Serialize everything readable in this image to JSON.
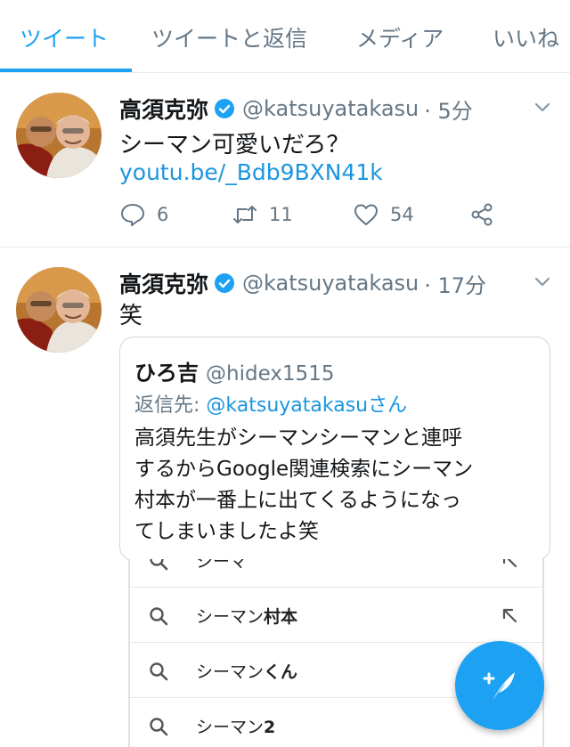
{
  "tabs": [
    {
      "label": "ツイート",
      "active": true
    },
    {
      "label": "ツイートと返信",
      "active": false
    },
    {
      "label": "メディア",
      "active": false
    },
    {
      "label": "いいね",
      "active": false
    }
  ],
  "colors": {
    "accent": "#1da1f2",
    "link": "#1b95e0",
    "muted": "#657786"
  },
  "tweets": [
    {
      "name": "高須克弥",
      "handle": "@katsuyatakasu",
      "time": "· 5分",
      "text": "シーマン可愛いだろ？",
      "link": "youtu.be/_Bdb9BXN41k",
      "replies": "6",
      "retweets": "11",
      "likes": "54"
    },
    {
      "name": "高須克弥",
      "handle": "@katsuyatakasu",
      "time": "· 17分",
      "text": "笑",
      "quote": {
        "name": "ひろ吉",
        "handle": "@hidex1515",
        "reply_prefix": "返信先: ",
        "reply_mention": "@katsuyatakasu",
        "reply_suffix": "さん",
        "lines": [
          "高須先生がシーマンシーマンと連呼",
          "するからGoogle関連検索にシーマン",
          "村本が一番上に出てくるようになっ",
          "てしまいましたよ笑"
        ]
      }
    }
  ],
  "suggestions": [
    {
      "prefix": "シーマ",
      "bold": ""
    },
    {
      "prefix": "シーマン",
      "bold": "村本"
    },
    {
      "prefix": "シーマン",
      "bold": "くん"
    },
    {
      "prefix": "シーマン",
      "bold": "2"
    }
  ],
  "icons": {
    "verified": "verified-badge-icon",
    "caret": "chevron-down-icon",
    "reply": "reply-icon",
    "retweet": "retweet-icon",
    "like": "heart-icon",
    "share": "share-icon",
    "compose": "compose-tweet-icon",
    "search": "search-icon",
    "arrow": "arrow-up-left-icon"
  }
}
